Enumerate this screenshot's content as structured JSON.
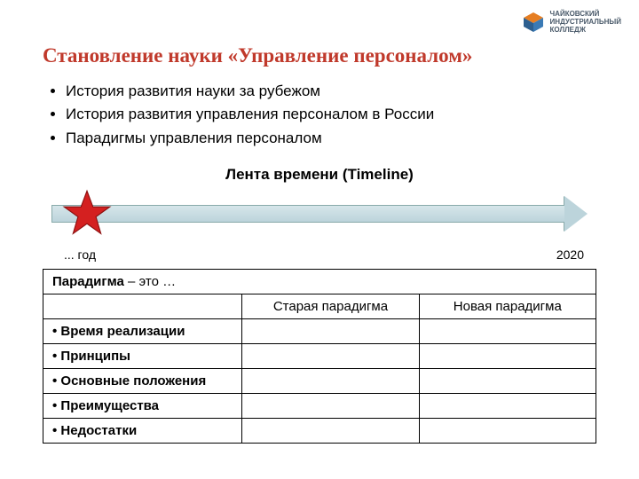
{
  "logo": {
    "line1": "ЧАЙКОВСКИЙ",
    "line2": "ИНДУСТРИАЛЬНЫЙ",
    "line3": "КОЛЛЕДЖ"
  },
  "title": "Становление науки «Управление персоналом»",
  "topics": [
    "История развития науки за рубежом",
    "История развития управления персоналом в России",
    "Парадигмы управления персоналом"
  ],
  "timeline": {
    "heading": "Лента времени (Timeline)",
    "start_label": "... год",
    "end_label": "2020"
  },
  "table": {
    "definition_term": "Парадигма",
    "definition_rest": " – это …",
    "col_old": "Старая парадигма",
    "col_new": "Новая парадигма",
    "rows": [
      "Время реализации",
      "Принципы",
      "Основные положения",
      "Преимущества",
      "Недостатки"
    ]
  }
}
